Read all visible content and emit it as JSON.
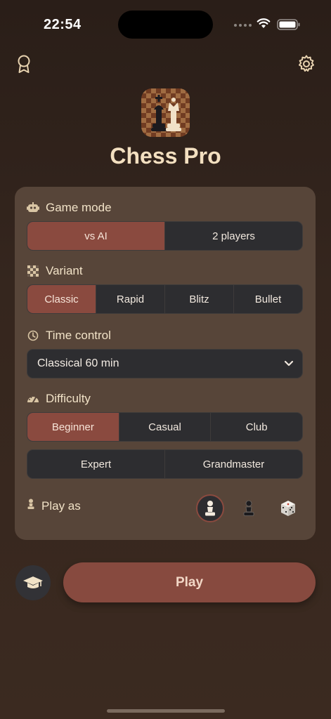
{
  "status_bar": {
    "time": "22:54"
  },
  "app": {
    "title": "Chess Pro"
  },
  "game_mode": {
    "label": "Game mode",
    "options": [
      "vs AI",
      "2 players"
    ],
    "selected": "vs AI"
  },
  "variant": {
    "label": "Variant",
    "options": [
      "Classic",
      "Rapid",
      "Blitz",
      "Bullet"
    ],
    "selected": "Classic"
  },
  "time_control": {
    "label": "Time control",
    "value": "Classical 60 min"
  },
  "difficulty": {
    "label": "Difficulty",
    "row1": [
      "Beginner",
      "Casual",
      "Club"
    ],
    "row2": [
      "Expert",
      "Grandmaster"
    ],
    "selected": "Beginner"
  },
  "play_as": {
    "label": "Play as",
    "options": [
      "white-pawn-icon",
      "black-pawn-icon",
      "dice-icon"
    ],
    "selected": "white-pawn-icon"
  },
  "actions": {
    "play_label": "Play"
  },
  "colors": {
    "accent": "#8a4a3f",
    "panel": "#574539",
    "control": "#2d2d30",
    "title": "#f3dfc0"
  }
}
